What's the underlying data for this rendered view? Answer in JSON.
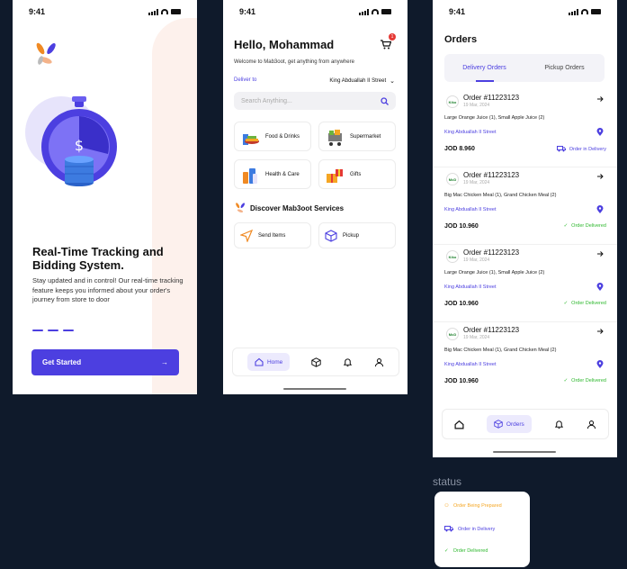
{
  "status_bar": {
    "time": "9:41"
  },
  "onboarding": {
    "title": "Real-Time Tracking and Bidding System.",
    "description": "Stay updated and in control! Our real-time tracking feature keeps you informed about your order's journey from store to door",
    "button_label": "Get Started"
  },
  "home": {
    "greeting": "Hello, Mohammad",
    "cart_count": "1",
    "welcome": "Welcome to Mab3oot, get anything from anywhere",
    "deliver_to_label": "Deliver to",
    "deliver_to_value": "King Abduallah II Street",
    "search_placeholder": "Search Anything...",
    "categories": [
      {
        "label": "Food & Drinks",
        "icon": "food-drinks-icon"
      },
      {
        "label": "Supermarket",
        "icon": "cart-basket-icon"
      },
      {
        "label": "Health & Care",
        "icon": "health-care-icon"
      },
      {
        "label": "Gifts",
        "icon": "gift-icon"
      }
    ],
    "discover_title": "Discover Mab3oot Services",
    "services": [
      {
        "label": "Send Items",
        "icon": "send-icon"
      },
      {
        "label": "Pickup",
        "icon": "box-icon"
      }
    ],
    "nav": {
      "home_label": "Home"
    }
  },
  "orders": {
    "title": "Orders",
    "tabs": [
      "Delivery Orders",
      "Pickup Orders"
    ],
    "list": [
      {
        "logo": "Kiko",
        "number": "Order #11223123",
        "date": "19 Mar, 2024",
        "items": "Large Orange Juice (1), Small Apple Juice (2)",
        "address": "King Abduallah II Street",
        "price": "JOD 8.960",
        "status": "Order in Delivery",
        "status_type": "delivery"
      },
      {
        "logo": "McD",
        "number": "Order #11223123",
        "date": "19 Mar, 2024",
        "items": "Big Mac Chicken Meal (1), Grand Chicken Meal (2)",
        "address": "King Abduallah II Street",
        "price": "JOD 10.960",
        "status": "Order Delivered",
        "status_type": "delivered"
      },
      {
        "logo": "Kiko",
        "number": "Order #11223123",
        "date": "19 Mar, 2024",
        "items": "Large Orange Juice (1), Small Apple Juice (2)",
        "address": "King Abduallah II Street",
        "price": "JOD 10.960",
        "status": "Order Delivered",
        "status_type": "delivered"
      },
      {
        "logo": "McD",
        "number": "Order #11223123",
        "date": "19 Mar, 2024",
        "items": "Big Mac Chicken Meal (1), Grand Chicken Meal (2)",
        "address": "King Abduallah II Street",
        "price": "JOD 10.960",
        "status": "Order Delivered",
        "status_type": "delivered"
      }
    ],
    "nav": {
      "orders_label": "Orders"
    }
  },
  "status_panel": {
    "label": "status",
    "items": [
      {
        "label": "Order Being Prepared",
        "color": "#f5a623"
      },
      {
        "label": "Order in Delivery",
        "color": "#4c3fe0"
      },
      {
        "label": "Order Delivered",
        "color": "#2eb82e"
      }
    ]
  },
  "colors": {
    "primary": "#4c3fe0",
    "background": "#0f1a2b"
  }
}
